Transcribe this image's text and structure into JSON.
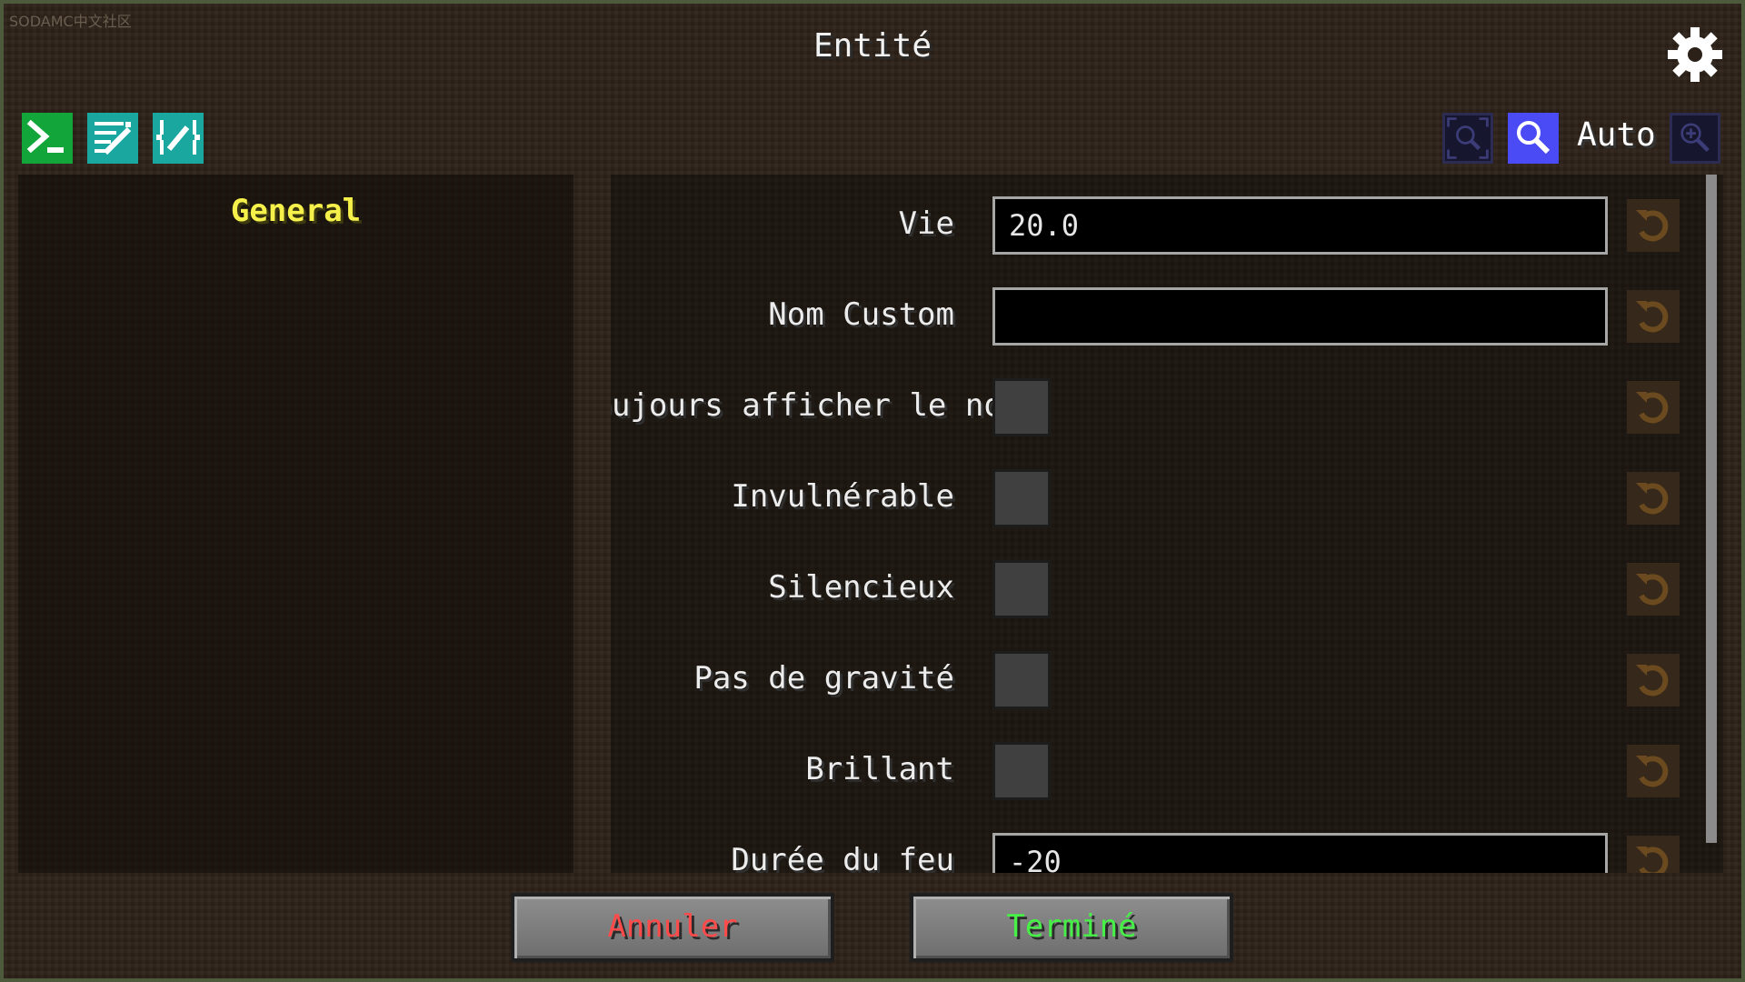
{
  "watermark": "SODAMC中文社区",
  "window": {
    "title": "Entité"
  },
  "toolbar": {
    "left_icons": [
      "terminal-icon",
      "edit-grid-icon",
      "edit-nbt-icon"
    ],
    "right_icons": [
      "zoom-fit-icon",
      "zoom-icon",
      "zoom-in-icon"
    ],
    "zoom_mode_label": "Auto"
  },
  "categories": [
    {
      "label": "General",
      "selected": true
    }
  ],
  "fields": [
    {
      "label": "Vie",
      "type": "text",
      "value": "20.0"
    },
    {
      "label": "Nom Custom",
      "type": "text",
      "value": ""
    },
    {
      "label": "Toujours afficher le nom",
      "type": "checkbox",
      "checked": false
    },
    {
      "label": "Invulnérable",
      "type": "checkbox",
      "checked": false
    },
    {
      "label": "Silencieux",
      "type": "checkbox",
      "checked": false
    },
    {
      "label": "Pas de gravité",
      "type": "checkbox",
      "checked": false
    },
    {
      "label": "Brillant",
      "type": "checkbox",
      "checked": false
    },
    {
      "label": "Durée du feu",
      "type": "text",
      "value": "-20"
    }
  ],
  "buttons": {
    "cancel": "Annuler",
    "done": "Terminé"
  },
  "colors": {
    "category_selected": "#f6f14a",
    "cancel_text": "#ff4a4a",
    "done_text": "#46f046",
    "zoom_active": "#4b4bf5",
    "tool_green": "#12a53a",
    "tool_teal": "#1aa7a0",
    "reset_icon": "#6a4a1e"
  }
}
